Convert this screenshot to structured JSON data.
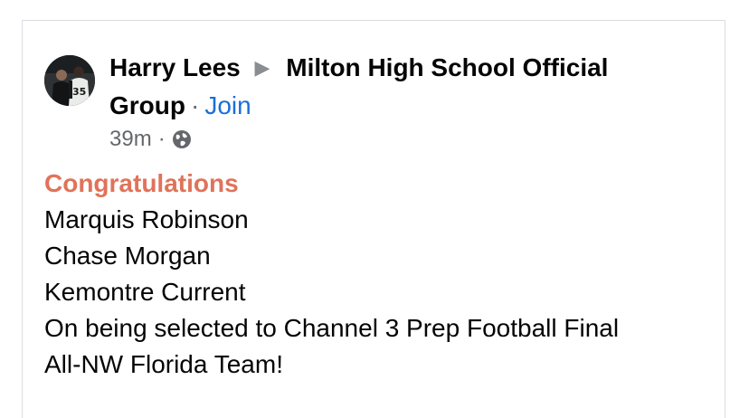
{
  "post": {
    "author": "Harry Lees",
    "arrow": "▶",
    "group_line1": "Milton High School Official",
    "group_line2": "Group",
    "dot": "·",
    "join_label": "Join",
    "timestamp": "39m",
    "privacy_icon": "globe-icon",
    "accent_color": "#e0735a",
    "link_color": "#1a6ed8",
    "body": {
      "headline": "Congratulations",
      "lines": [
        "Marquis Robinson",
        "Chase Morgan",
        "Kemontre Current",
        "On being selected to Channel 3 Prep Football Final",
        "All-NW Florida Team!"
      ]
    }
  }
}
